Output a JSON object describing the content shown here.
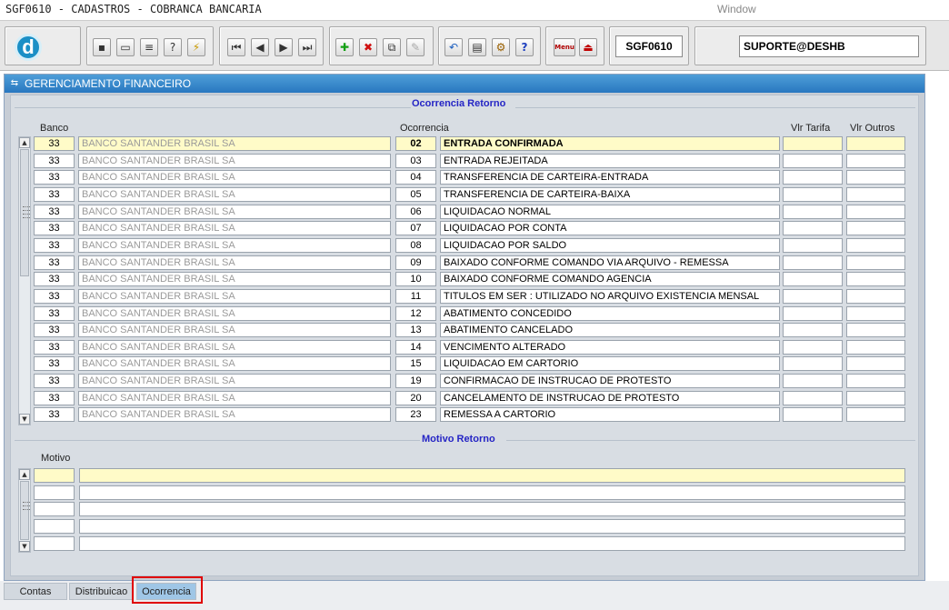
{
  "titlebar": {
    "title": "SGF0610 - CADASTROS - COBRANCA BANCARIA",
    "window_menu": "Window"
  },
  "toolbar": {
    "logo_letter": "d",
    "form_code": "SGF0610",
    "user": "SUPORTE@DESHB",
    "menu_label": "Menu"
  },
  "panel": {
    "title": "GERENCIAMENTO FINANCEIRO"
  },
  "ocorrencia": {
    "section_title": "Ocorrencia Retorno",
    "columns": {
      "banco": "Banco",
      "ocorrencia": "Ocorrencia",
      "vlr_tarifa": "Vlr Tarifa",
      "vlr_outros": "Vlr Outros"
    },
    "rows": [
      {
        "banco": "33",
        "banco_nome": "BANCO SANTANDER BRASIL SA",
        "codigo": "02",
        "descricao": "ENTRADA CONFIRMADA",
        "vlr_tarifa": "",
        "vlr_outros": ""
      },
      {
        "banco": "33",
        "banco_nome": "BANCO SANTANDER BRASIL SA",
        "codigo": "03",
        "descricao": "ENTRADA REJEITADA",
        "vlr_tarifa": "",
        "vlr_outros": ""
      },
      {
        "banco": "33",
        "banco_nome": "BANCO SANTANDER BRASIL SA",
        "codigo": "04",
        "descricao": "TRANSFERENCIA DE CARTEIRA-ENTRADA",
        "vlr_tarifa": "",
        "vlr_outros": ""
      },
      {
        "banco": "33",
        "banco_nome": "BANCO SANTANDER BRASIL SA",
        "codigo": "05",
        "descricao": "TRANSFERENCIA DE CARTEIRA-BAIXA",
        "vlr_tarifa": "",
        "vlr_outros": ""
      },
      {
        "banco": "33",
        "banco_nome": "BANCO SANTANDER BRASIL SA",
        "codigo": "06",
        "descricao": "LIQUIDACAO NORMAL",
        "vlr_tarifa": "",
        "vlr_outros": ""
      },
      {
        "banco": "33",
        "banco_nome": "BANCO SANTANDER BRASIL SA",
        "codigo": "07",
        "descricao": "LIQUIDACAO POR CONTA",
        "vlr_tarifa": "",
        "vlr_outros": ""
      },
      {
        "banco": "33",
        "banco_nome": "BANCO SANTANDER BRASIL SA",
        "codigo": "08",
        "descricao": "LIQUIDACAO POR SALDO",
        "vlr_tarifa": "",
        "vlr_outros": ""
      },
      {
        "banco": "33",
        "banco_nome": "BANCO SANTANDER BRASIL SA",
        "codigo": "09",
        "descricao": "BAIXADO CONFORME COMANDO VIA ARQUIVO - REMESSA",
        "vlr_tarifa": "",
        "vlr_outros": ""
      },
      {
        "banco": "33",
        "banco_nome": "BANCO SANTANDER BRASIL SA",
        "codigo": "10",
        "descricao": "BAIXADO CONFORME COMANDO AGENCIA",
        "vlr_tarifa": "",
        "vlr_outros": ""
      },
      {
        "banco": "33",
        "banco_nome": "BANCO SANTANDER BRASIL SA",
        "codigo": "11",
        "descricao": "TITULOS EM SER : UTILIZADO NO ARQUIVO EXISTENCIA MENSAL",
        "vlr_tarifa": "",
        "vlr_outros": ""
      },
      {
        "banco": "33",
        "banco_nome": "BANCO SANTANDER BRASIL SA",
        "codigo": "12",
        "descricao": "ABATIMENTO CONCEDIDO",
        "vlr_tarifa": "",
        "vlr_outros": ""
      },
      {
        "banco": "33",
        "banco_nome": "BANCO SANTANDER BRASIL SA",
        "codigo": "13",
        "descricao": "ABATIMENTO CANCELADO",
        "vlr_tarifa": "",
        "vlr_outros": ""
      },
      {
        "banco": "33",
        "banco_nome": "BANCO SANTANDER BRASIL SA",
        "codigo": "14",
        "descricao": "VENCIMENTO ALTERADO",
        "vlr_tarifa": "",
        "vlr_outros": ""
      },
      {
        "banco": "33",
        "banco_nome": "BANCO SANTANDER BRASIL SA",
        "codigo": "15",
        "descricao": "LIQUIDACAO EM CARTORIO",
        "vlr_tarifa": "",
        "vlr_outros": ""
      },
      {
        "banco": "33",
        "banco_nome": "BANCO SANTANDER BRASIL SA",
        "codigo": "19",
        "descricao": "CONFIRMACAO DE INSTRUCAO DE PROTESTO",
        "vlr_tarifa": "",
        "vlr_outros": ""
      },
      {
        "banco": "33",
        "banco_nome": "BANCO SANTANDER BRASIL SA",
        "codigo": "20",
        "descricao": "CANCELAMENTO DE INSTRUCAO DE PROTESTO",
        "vlr_tarifa": "",
        "vlr_outros": ""
      },
      {
        "banco": "33",
        "banco_nome": "BANCO SANTANDER BRASIL SA",
        "codigo": "23",
        "descricao": "REMESSA A CARTORIO",
        "vlr_tarifa": "",
        "vlr_outros": ""
      }
    ],
    "selected_row": 0
  },
  "motivo": {
    "section_title": "Motivo Retorno",
    "column_label": "Motivo",
    "rows": [
      {
        "codigo": "",
        "descricao": ""
      },
      {
        "codigo": "",
        "descricao": ""
      },
      {
        "codigo": "",
        "descricao": ""
      },
      {
        "codigo": "",
        "descricao": ""
      },
      {
        "codigo": "",
        "descricao": ""
      }
    ],
    "selected_row": 0
  },
  "tabs": [
    {
      "label": "Contas",
      "active": false
    },
    {
      "label": "Distribuicao",
      "active": false
    },
    {
      "label": "Ocorrencia",
      "active": true
    }
  ],
  "colors": {
    "header_blue": "#2877c0",
    "section_title": "#2525c5",
    "selected_row": "#fffbc8",
    "highlight": "#e00000"
  }
}
